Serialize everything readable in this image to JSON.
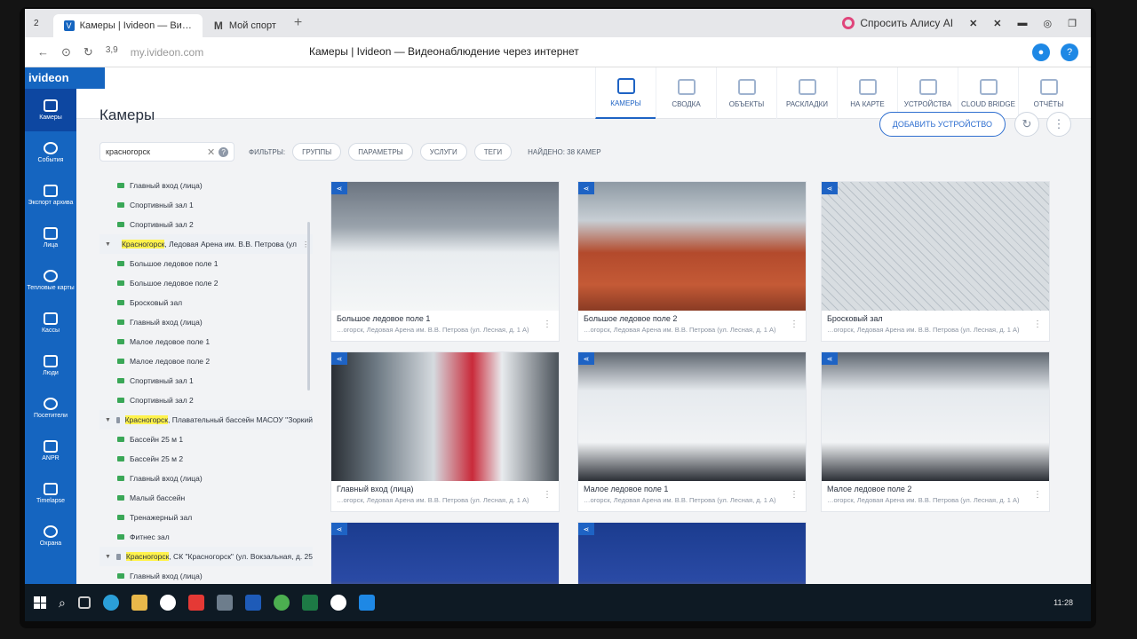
{
  "browser": {
    "tabs": [
      {
        "label": "Камеры | Ivideon — Ви…",
        "favicon": "ivideon-icon"
      },
      {
        "label": "Мой спорт",
        "favicon": "gmail-icon"
      }
    ],
    "tab_count": "2",
    "new_tab": "+",
    "alice_label": "Спросить Алису AI",
    "rating": "3,9",
    "url": "my.ivideon.com",
    "page_title": "Камеры | Ivideon — Видеонаблюдение через интернет",
    "help": "?"
  },
  "app": {
    "logo": "ivideon",
    "title": "Камеры",
    "add_device": "ДОБАВИТЬ УСТРОЙСТВО",
    "accent": "#1565c0"
  },
  "topnav": [
    {
      "label": "КАМЕРЫ",
      "active": true
    },
    {
      "label": "СВОДКА"
    },
    {
      "label": "ОБЪЕКТЫ"
    },
    {
      "label": "РАСКЛАДКИ"
    },
    {
      "label": "НА КАРТЕ"
    },
    {
      "label": "УСТРОЙСТВА"
    },
    {
      "label": "CLOUD BRIDGE"
    },
    {
      "label": "ОТЧЁТЫ"
    }
  ],
  "rail": [
    {
      "label": "Камеры",
      "active": true
    },
    {
      "label": "События"
    },
    {
      "label": "Экспорт архива"
    },
    {
      "label": "Лица"
    },
    {
      "label": "Тепловые карты"
    },
    {
      "label": "Кассы"
    },
    {
      "label": "Люди"
    },
    {
      "label": "Посетители"
    },
    {
      "label": "ANPR"
    },
    {
      "label": "Timelapse"
    },
    {
      "label": "Охрана"
    }
  ],
  "filters": {
    "search_value": "красногорск",
    "label": "ФИЛЬТРЫ:",
    "chips": [
      "ГРУППЫ",
      "ПАРАМЕТРЫ",
      "УСЛУГИ",
      "ТЕГИ"
    ],
    "found": "НАЙДЕНО: 38 КАМЕР"
  },
  "tree": [
    {
      "type": "cam",
      "label": "Главный вход (лица)"
    },
    {
      "type": "cam",
      "label": "Спортивный зал 1"
    },
    {
      "type": "cam",
      "label": "Спортивный зал 2"
    },
    {
      "type": "folder",
      "hl": "Красногорск",
      "rest": ", Ледовая Арена им. В.В. Петрова (ул"
    },
    {
      "type": "cam",
      "label": "Большое ледовое поле 1"
    },
    {
      "type": "cam",
      "label": "Большое ледовое поле 2"
    },
    {
      "type": "cam",
      "label": "Бросковый зал"
    },
    {
      "type": "cam",
      "label": "Главный вход (лица)"
    },
    {
      "type": "cam",
      "label": "Малое ледовое поле 1"
    },
    {
      "type": "cam",
      "label": "Малое ледовое поле 2"
    },
    {
      "type": "cam",
      "label": "Спортивный зал 1"
    },
    {
      "type": "cam",
      "label": "Спортивный зал 2"
    },
    {
      "type": "folder",
      "hl": "Красногорск",
      "rest": ", Плавательный бассейн МАСОУ \"Зоркий"
    },
    {
      "type": "cam",
      "label": "Бассейн 25 м 1"
    },
    {
      "type": "cam",
      "label": "Бассейн 25 м 2"
    },
    {
      "type": "cam",
      "label": "Главный вход (лица)"
    },
    {
      "type": "cam",
      "label": "Малый бассейн"
    },
    {
      "type": "cam",
      "label": "Тренажерный зал"
    },
    {
      "type": "cam",
      "label": "Фитнес зал"
    },
    {
      "type": "folder",
      "hl": "Красногорск",
      "rest": ", СК \"Красногорск\" (ул. Вокзальная, д. 25"
    },
    {
      "type": "cam",
      "label": "Главный вход (лица)"
    }
  ],
  "cameras": [
    {
      "name": "Большое ледовое поле 1",
      "address": "…огорск, Ледовая Арена им. В.В. Петрова (ул. Лесная, д. 1 А)",
      "scene": "rink"
    },
    {
      "name": "Большое ледовое поле 2",
      "address": "…огорск, Ледовая Арена им. В.В. Петрова (ул. Лесная, д. 1 А)",
      "scene": "seats"
    },
    {
      "name": "Бросковый зал",
      "address": "…огорск, Ледовая Арена им. В.В. Петрова (ул. Лесная, д. 1 А)",
      "scene": "net"
    },
    {
      "name": "Главный вход (лица)",
      "address": "…огорск, Ледовая Арена им. В.В. Петрова (ул. Лесная, д. 1 А)",
      "scene": "lobby"
    },
    {
      "name": "Малое ледовое поле 1",
      "address": "…огорск, Ледовая Арена им. В.В. Петрова (ул. Лесная, д. 1 А)",
      "scene": "rail-rink"
    },
    {
      "name": "Малое ледовое поле 2",
      "address": "…огорск, Ледовая Арена им. В.В. Петрова (ул. Лесная, д. 1 А)",
      "scene": "rail-rink"
    },
    {
      "name": "",
      "address": "",
      "scene": "gym"
    },
    {
      "name": "",
      "address": "",
      "scene": "gym"
    }
  ],
  "taskbar": {
    "clock": "11:28"
  }
}
